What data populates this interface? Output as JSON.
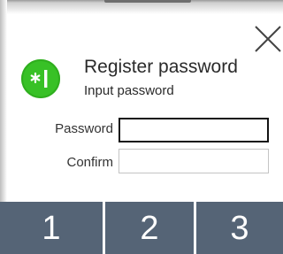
{
  "dialog": {
    "title": "Register password",
    "subtitle": "Input password",
    "icon": "password-cursor-icon",
    "accent_color": "#38c126"
  },
  "form": {
    "password_label": "Password",
    "password_value": "",
    "confirm_label": "Confirm",
    "confirm_value": ""
  },
  "keypad": {
    "keys": [
      "1",
      "2",
      "3"
    ],
    "key_color": "#556476"
  },
  "close_icon": "close-icon"
}
